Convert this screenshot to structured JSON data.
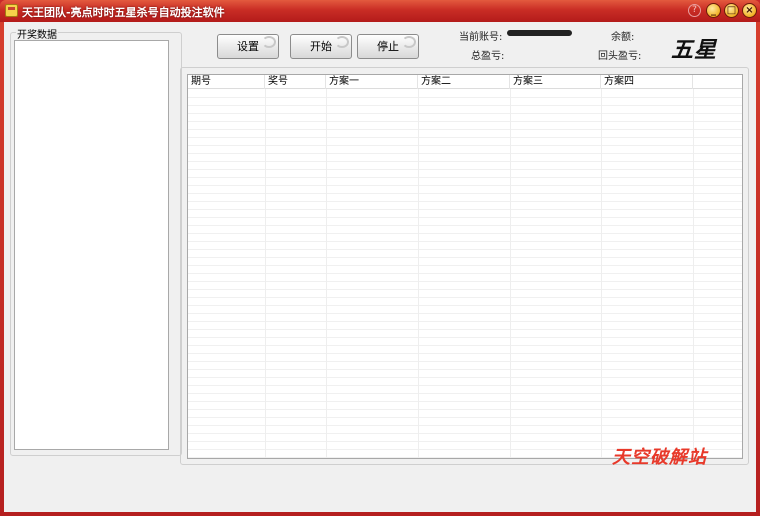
{
  "window": {
    "title": "天王团队-亮点时时五星杀号自动投注软件",
    "help_glyph": "?",
    "minimize_glyph": "_",
    "maximize_glyph": "□",
    "close_glyph": "×"
  },
  "left_panel": {
    "label": "开奖数据"
  },
  "toolbar": {
    "settings_label": "设置",
    "start_label": "开始",
    "stop_label": "停止"
  },
  "account": {
    "current_account_label": "当前账号:",
    "balance_label": "余额:",
    "total_profit_label": "总盈亏:",
    "pullback_label": "回头盈亏:"
  },
  "logo_text": "五星",
  "table": {
    "columns": [
      "期号",
      "奖号",
      "方案一",
      "方案二",
      "方案三",
      "方案四"
    ]
  },
  "watermark": "天空破解站"
}
